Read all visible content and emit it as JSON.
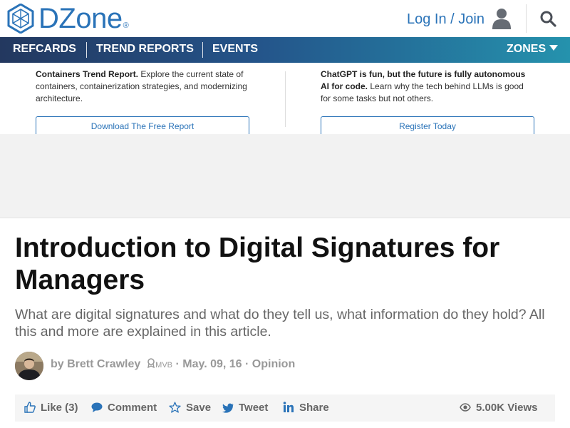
{
  "brand": {
    "name": "DZone",
    "reg_mark": "®",
    "color": "#2a73b8"
  },
  "header": {
    "login_label": "Log In / Join"
  },
  "nav": {
    "items": [
      "REFCARDS",
      "TREND REPORTS",
      "EVENTS"
    ],
    "zones_label": "ZONES"
  },
  "promos": [
    {
      "title": "Containers Trend Report.",
      "body": " Explore the current state of containers, containerization strategies, and modernizing architecture.",
      "button": "Download The Free Report"
    },
    {
      "title": "ChatGPT is fun, but the future is fully autonomous AI for code.",
      "body": " Learn why the tech behind LLMs is good for some tasks but not others.",
      "button": "Register Today"
    }
  ],
  "article": {
    "title": "Introduction to Digital Signatures for Managers",
    "subtitle": "What are digital signatures and what do they tell us, what information do they hold? All this and more are explained in this article.",
    "byline_prefix": "by",
    "author": "Brett Crawley",
    "badge": "MVB",
    "date": "May. 09, 16",
    "category": "Opinion",
    "separator": "·"
  },
  "actions": {
    "like": "Like (3)",
    "comment": "Comment",
    "save": "Save",
    "tweet": "Tweet",
    "share": "Share",
    "views": "5.00K Views"
  }
}
